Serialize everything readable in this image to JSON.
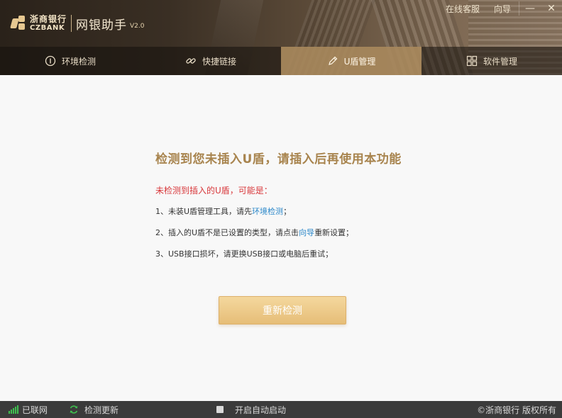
{
  "header": {
    "logo_cn": "浙商银行",
    "logo_en": "CZBANK",
    "app_title": "网银助手",
    "app_version": "V2.0",
    "top_links": [
      "在线客服",
      "向导"
    ],
    "minimize": "—",
    "close": "✕"
  },
  "tabs": [
    {
      "label": "环境检测",
      "icon": "info-circle-icon"
    },
    {
      "label": "快捷链接",
      "icon": "link-icon"
    },
    {
      "label": "U盾管理",
      "icon": "pen-icon"
    },
    {
      "label": "软件管理",
      "icon": "grid-icon"
    }
  ],
  "active_tab": 2,
  "main": {
    "title": "检测到您未插入U盾，请插入后再使用本功能",
    "reason_head": "未检测到插入的U盾，可能是：",
    "r1_prefix": "1、未装U盾管理工具，请先",
    "r1_link": "环境检测",
    "r1_suffix": "；",
    "r2_prefix": "2、插入的U盾不是已设置的类型，请点击",
    "r2_link": "向导",
    "r2_suffix": "重新设置；",
    "r3": "3、USB接口损坏，请更换USB接口或电脑后重试；",
    "retry_label": "重新检测"
  },
  "status": {
    "network": "已联网",
    "check_update": "检测更新",
    "autostart": "开启自动启动",
    "copyright": "©浙商银行 版权所有"
  },
  "colors": {
    "accent_gold": "#a8844e",
    "warning_red": "#d8383b",
    "link_blue": "#2a87c9",
    "signal_green": "#3fbf4f"
  }
}
